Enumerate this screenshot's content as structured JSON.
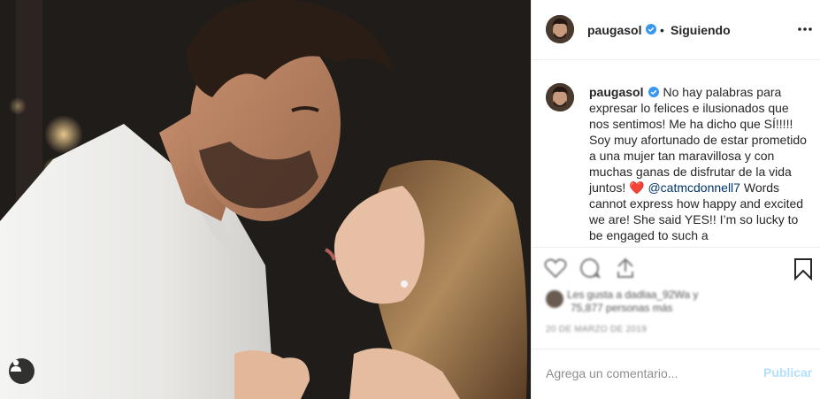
{
  "post": {
    "username": "paugasol",
    "separator": "•",
    "follow_status": "Siguiendo",
    "caption_text": "No hay palabras para expresar lo felices e ilusionados que nos sentimos! Me ha dicho que SÍ!!!!! Soy muy afortunado de estar prometido a una mujer tan maravillosa y con muchas ganas de disfrutar de la vida juntos! ",
    "caption_heart": "❤️",
    "caption_mention": "@catmcdonnell7",
    "caption_text_2": "Words cannot express how happy and excited we are! She said YES!! I’m so lucky to be engaged to such a",
    "likes_line_1": "Les gusta a dadlaa_92Wa y",
    "likes_line_2": "75,877 personas más",
    "date": "20 DE MARZO DE 2019"
  },
  "comment": {
    "placeholder": "Agrega un comentario...",
    "publish_label": "Publicar"
  },
  "icons": {
    "verified": "verified-badge-icon",
    "more": "more-options-icon",
    "like": "heart-icon",
    "comment": "comment-icon",
    "share": "share-icon",
    "save": "bookmark-icon",
    "tag": "user-tag-icon"
  },
  "colors": {
    "verified": "#3897f0",
    "mention": "#003569",
    "publish_disabled": "#b2dffc",
    "muted": "#8e8e8e"
  }
}
